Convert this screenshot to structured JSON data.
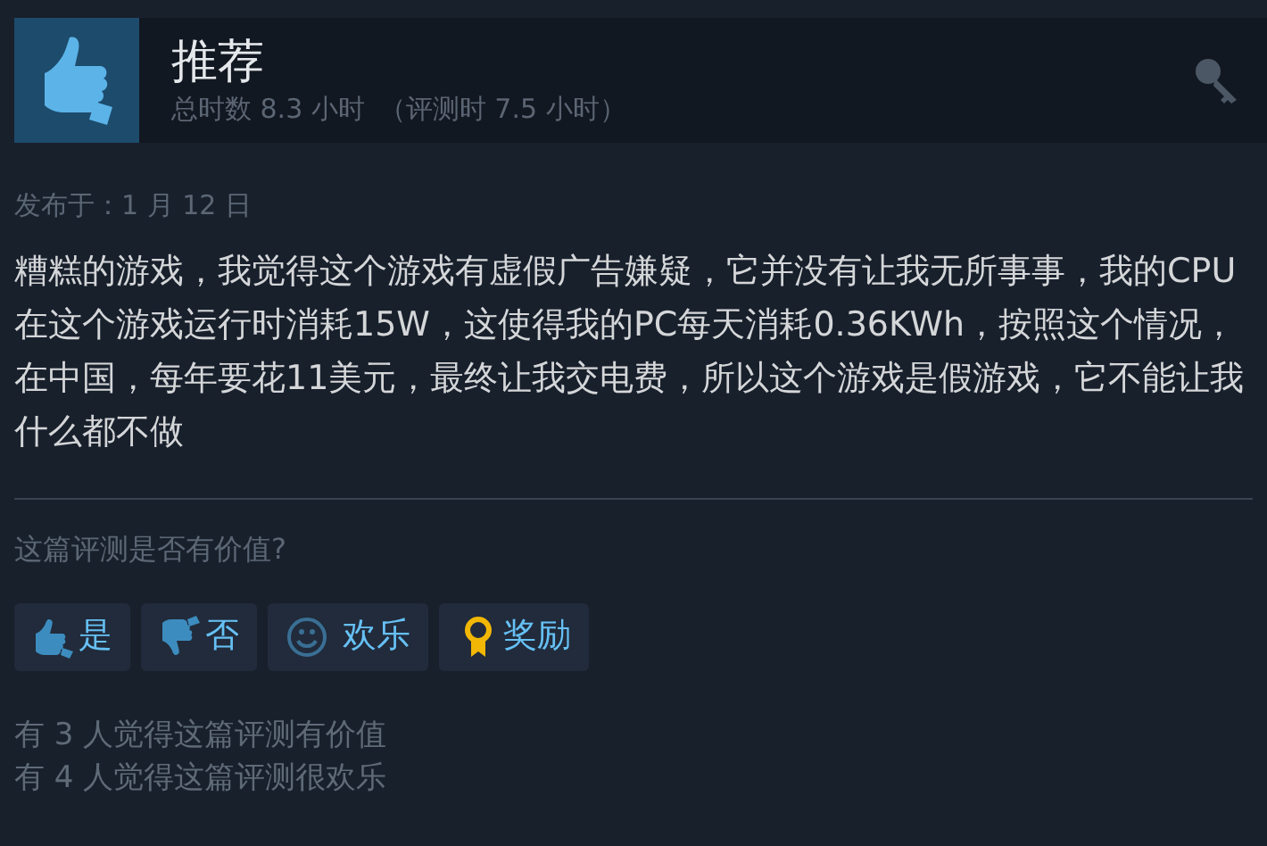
{
  "header": {
    "title": "推荐",
    "hours": "总时数 8.3 小时",
    "review_hours": "（评测时 7.5 小时）"
  },
  "posted": "发布于：1 月 12 日",
  "review_text": "糟糕的游戏，我觉得这个游戏有虚假广告嫌疑，它并没有让我无所事事，我的CPU在这个游戏运行时消耗15W，这使得我的PC每天消耗0.36KWh，按照这个情况，在中国，每年要花11美元，最终让我交电费，所以这个游戏是假游戏，它不能让我什么都不做",
  "question": "这篇评测是否有价值?",
  "buttons": [
    {
      "kind": "thumb_up",
      "label": "是"
    },
    {
      "kind": "thumb_down",
      "label": "否"
    },
    {
      "kind": "smile",
      "label": "欢乐"
    },
    {
      "kind": "award",
      "label": "奖励"
    }
  ],
  "stats": [
    "有 3 人觉得这篇评测有价值",
    "有 4 人觉得这篇评测很欢乐"
  ]
}
